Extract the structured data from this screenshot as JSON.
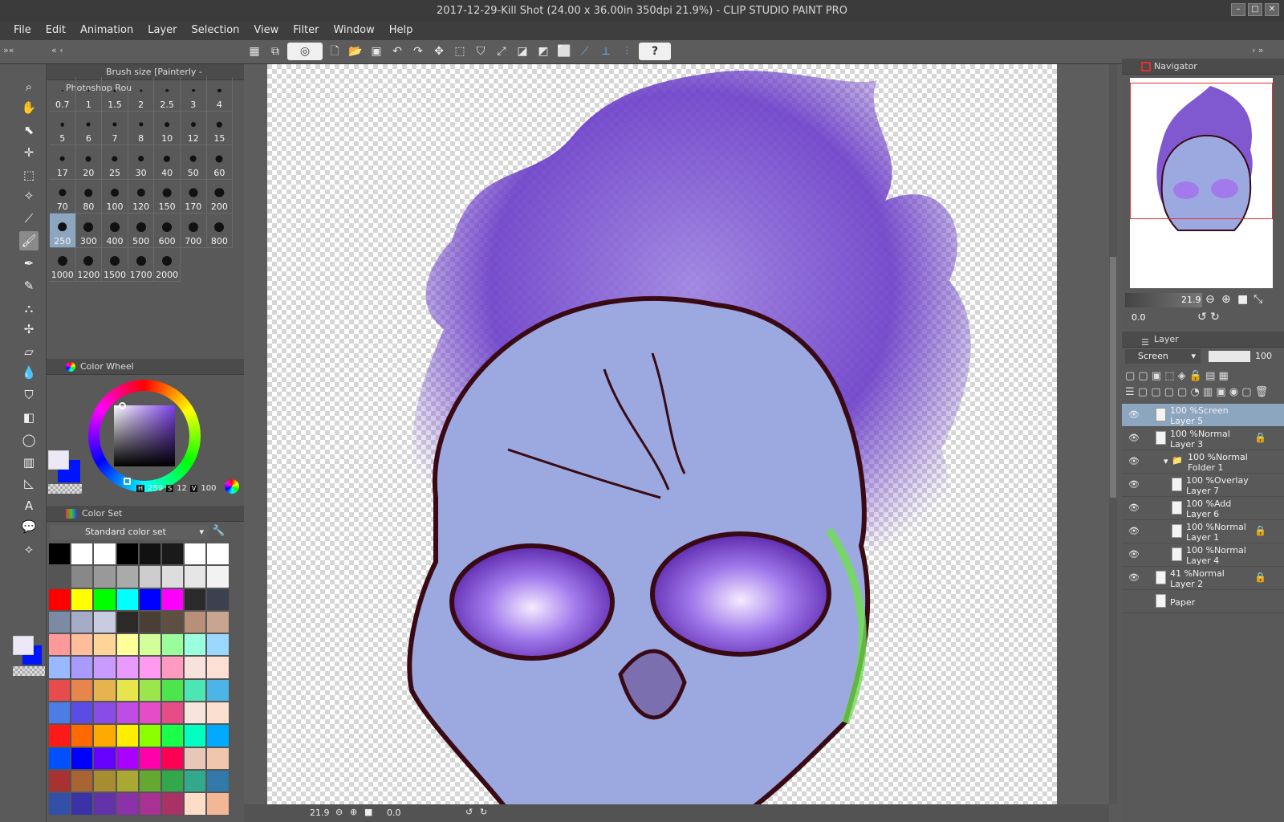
{
  "window": {
    "title": "2017-12-29-Kill Shot (24.00 x 36.00in 350dpi 21.9%)  - CLIP STUDIO PAINT PRO",
    "controls": [
      "–",
      "□",
      "✕"
    ]
  },
  "menu": [
    "File",
    "Edit",
    "Animation",
    "Layer",
    "Selection",
    "View",
    "Filter",
    "Window",
    "Help"
  ],
  "command_bar": {
    "help_label": "?"
  },
  "brush_panel": {
    "title": "Brush size [Painterly - Photoshop Rou",
    "sizes": [
      "0.7",
      "1",
      "1.5",
      "2",
      "2.5",
      "3",
      "4",
      "5",
      "6",
      "7",
      "8",
      "10",
      "12",
      "15",
      "17",
      "20",
      "25",
      "30",
      "40",
      "50",
      "60",
      "70",
      "80",
      "100",
      "120",
      "150",
      "170",
      "200",
      "250",
      "300",
      "400",
      "500",
      "600",
      "700",
      "800",
      "1000",
      "1200",
      "1500",
      "1700",
      "2000"
    ],
    "selected": "250"
  },
  "color_wheel": {
    "title": "Color Wheel",
    "h_label": "H",
    "h": "259",
    "s_label": "S",
    "s": "12",
    "v_label": "V",
    "v": "100",
    "main_color": "#ece8f8",
    "sub_color": "#0014ff"
  },
  "color_set": {
    "title": "Color Set",
    "selected_set": "Standard color set",
    "swatches": [
      "#000000",
      "#ffffff",
      "#ffffff",
      "#000000",
      "#111111",
      "#1a1a1a",
      "#ffffff",
      "#ffffff",
      "#555555",
      "#888888",
      "#999999",
      "#aaaaaa",
      "#cccccc",
      "#dddddd",
      "#e6e6e6",
      "#f2f2f2",
      "#ff0000",
      "#ffff00",
      "#00ff00",
      "#00ffff",
      "#0000ff",
      "#ff00ff",
      "#2b2b2b",
      "#3c4150",
      "#7d8aa6",
      "#a5acc7",
      "#c7cbe0",
      "#2c2a27",
      "#4a3f35",
      "#5e5040",
      "#b8907a",
      "#c9a491",
      "#ff9a9a",
      "#ffbe9a",
      "#ffd59a",
      "#ffff9a",
      "#d2ff9a",
      "#9aff9a",
      "#9affdf",
      "#9ad8ff",
      "#9ab8ff",
      "#a89aff",
      "#c99aff",
      "#e89aff",
      "#ff9af0",
      "#ff9ac0",
      "#fae2dc",
      "#fde0d3",
      "#e64c4c",
      "#e6864c",
      "#e6b44c",
      "#e6e64c",
      "#9ae64c",
      "#4ce64c",
      "#4ce6b4",
      "#4cb4e6",
      "#4c7ce6",
      "#5c4ce6",
      "#8a4ce6",
      "#c04ce6",
      "#e64cc8",
      "#e64c86",
      "#f7e4dd",
      "#fbdfcf",
      "#ff1a1a",
      "#ff6a00",
      "#ffaa00",
      "#ffee00",
      "#8cff00",
      "#1aff4a",
      "#00ffc0",
      "#00aaff",
      "#0050ff",
      "#0000ff",
      "#6600ff",
      "#aa00ff",
      "#ff00aa",
      "#ff0055",
      "#e8c6b8",
      "#f0c6ad",
      "#a83232",
      "#a86432",
      "#a88c32",
      "#a8a832",
      "#64a832",
      "#32a84a",
      "#32a88c",
      "#3278a8",
      "#3250a8",
      "#3c32a8",
      "#6432a8",
      "#8c32a8",
      "#a83294",
      "#a83264",
      "#fddcc8",
      "#f2b797"
    ]
  },
  "canvas": {
    "zoom": "21.9",
    "rotation": "0.0"
  },
  "navigator": {
    "title": "Navigator",
    "zoom": "21.9",
    "rotation": "0.0"
  },
  "layer_panel": {
    "title": "Layer",
    "blend_mode": "Screen",
    "opacity": "100",
    "layers": [
      {
        "line1": "100 %Screen",
        "line2": "Layer 5",
        "indent": 0,
        "selected": true,
        "locked": false,
        "visible": true
      },
      {
        "line1": "100 %Normal",
        "line2": "Layer 3",
        "indent": 0,
        "selected": false,
        "locked": true,
        "visible": true
      },
      {
        "line1": "100 %Normal",
        "line2": "Folder 1",
        "indent": 1,
        "selected": false,
        "locked": false,
        "visible": true,
        "folder": true
      },
      {
        "line1": "100 %Overlay",
        "line2": "Layer 7",
        "indent": 2,
        "selected": false,
        "locked": false,
        "visible": true
      },
      {
        "line1": "100 %Add",
        "line2": "Layer 6",
        "indent": 2,
        "selected": false,
        "locked": false,
        "visible": true
      },
      {
        "line1": "100 %Normal",
        "line2": "Layer 1",
        "indent": 2,
        "selected": false,
        "locked": true,
        "visible": true
      },
      {
        "line1": "100 %Normal",
        "line2": "Layer 4",
        "indent": 2,
        "selected": false,
        "locked": false,
        "visible": true
      },
      {
        "line1": "41 %Normal",
        "line2": "Layer 2",
        "indent": 0,
        "selected": false,
        "locked": true,
        "visible": true
      },
      {
        "line1": "",
        "line2": "Paper",
        "indent": 0,
        "selected": false,
        "locked": false,
        "visible": false
      }
    ]
  }
}
